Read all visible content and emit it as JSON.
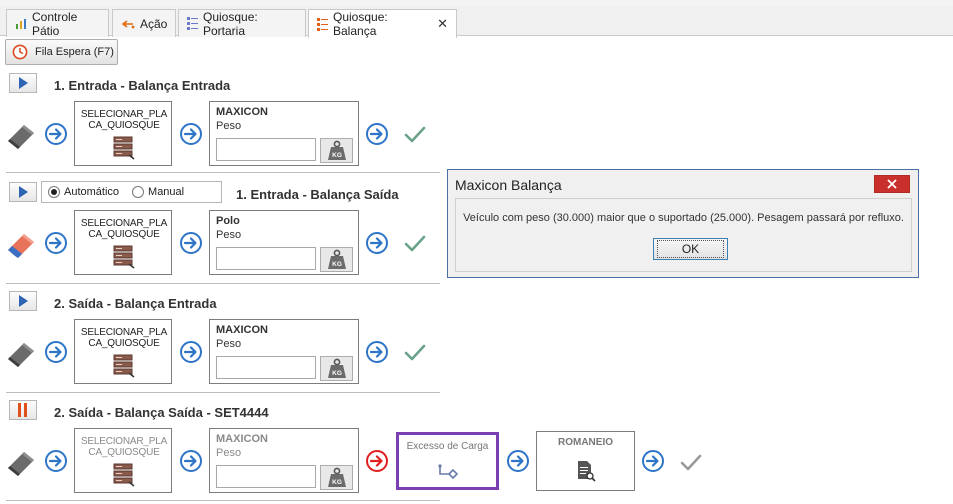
{
  "tabs": [
    {
      "label": "Controle Pátio"
    },
    {
      "label": "Ação"
    },
    {
      "label": "Quiosque: Portaria"
    },
    {
      "label": "Quiosque: Balança"
    }
  ],
  "toolbar": {
    "queue_label": "Fila Espera (F7)"
  },
  "sections": [
    {
      "title": "1. Entrada - Balança Entrada",
      "quiosque": "SELECIONAR_PLACA_QUIOSQUE",
      "scale_name": "MAXICON",
      "scale_sub": "Peso",
      "kg": "KG"
    },
    {
      "title": "1. Entrada - Balança Saída",
      "quiosque": "SELECIONAR_PLACA_QUIOSQUE",
      "scale_name": "Polo",
      "scale_sub": "Peso",
      "kg": "KG"
    },
    {
      "title": "2. Saída - Balança Entrada",
      "quiosque": "SELECIONAR_PLACA_QUIOSQUE",
      "scale_name": "MAXICON",
      "scale_sub": "Peso",
      "kg": "KG"
    },
    {
      "title": "2. Saída - Balança Saída - SET4444",
      "quiosque": "SELECIONAR_PLACA_QUIOSQUE",
      "scale_name": "MAXICON",
      "scale_sub": "Peso",
      "kg": "KG"
    }
  ],
  "mode": {
    "auto": "Automático",
    "manual": "Manual",
    "selected": "Automático"
  },
  "steps": {
    "excess": "Excesso de Carga",
    "romaneio": "ROMANEIO"
  },
  "dialog": {
    "title": "Maxicon Balança",
    "message": "Veículo com peso (30.000) maior que o suportado (25.000). Pesagem passará por refluxo.",
    "ok": "OK"
  },
  "colors": {
    "accent_blue": "#2e75c8",
    "check_green": "#6aa389",
    "error_red": "#e02020",
    "highlight_purple": "#7a3fb0",
    "pause_orange": "#e0501a"
  }
}
